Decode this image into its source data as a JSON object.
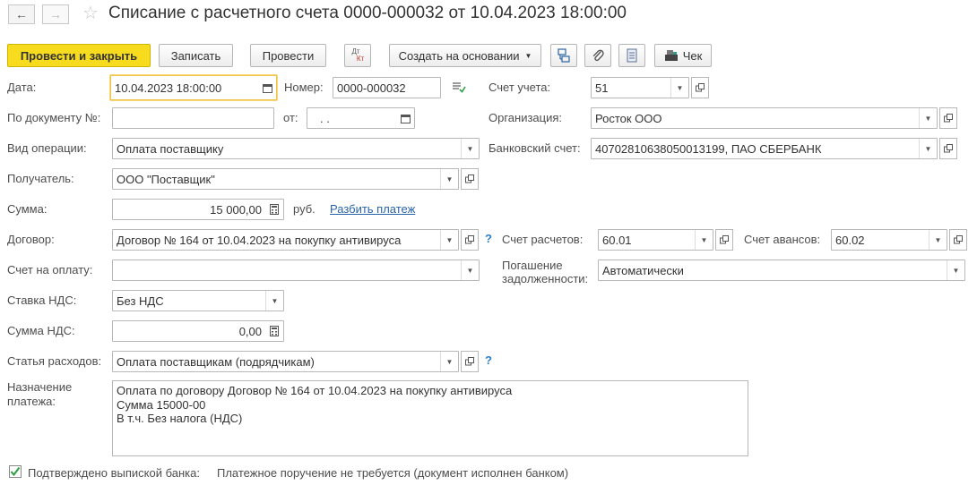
{
  "window": {
    "title": "Списание с расчетного счета 0000-000032 от 10.04.2023 18:00:00",
    "back_glyph": "←",
    "forward_glyph": "→",
    "favorite_glyph": "☆"
  },
  "toolbar": {
    "post_close": "Провести и закрыть",
    "save": "Записать",
    "post": "Провести",
    "dtkt_top": "Дт",
    "dtkt_bottom": "Кт",
    "create_based": "Создать на основании",
    "check": "Чек"
  },
  "icons": {
    "dropdown": "▾",
    "dropdown_small": "▼"
  },
  "form": {
    "date_label": "Дата:",
    "date_value": "10.04.2023 18:00:00",
    "number_label": "Номер:",
    "number_value": "0000-000032",
    "account_label": "Счет учета:",
    "account_value": "51",
    "bydoc_label": "По документу №:",
    "bydoc_value": "",
    "from_label": "от:",
    "from_value": " .  .",
    "org_label": "Организация:",
    "org_value": "Росток ООО",
    "optype_label": "Вид операции:",
    "optype_value": "Оплата поставщику",
    "bank_label": "Банковский счет:",
    "bank_value": "40702810638050013199, ПАО СБЕРБАНК",
    "recipient_label": "Получатель:",
    "recipient_value": "ООО \"Поставщик\"",
    "sum_label": "Сумма:",
    "sum_value": "15 000,00",
    "currency": "руб.",
    "split_link": "Разбить платеж",
    "contract_label": "Договор:",
    "contract_value": "Договор № 164 от 10.04.2023 на покупку антивируса",
    "help_mark": "?",
    "settle_label": "Счет расчетов:",
    "settle_value": "60.01",
    "advance_label": "Счет авансов:",
    "advance_value": "60.02",
    "invoice_label": "Счет на оплату:",
    "invoice_value": "",
    "repay_label_1": "Погашение",
    "repay_label_2": "задолженности:",
    "repay_value": "Автоматически",
    "vat_rate_label": "Ставка НДС:",
    "vat_rate_value": "Без НДС",
    "vat_sum_label": "Сумма НДС:",
    "vat_sum_value": "0,00",
    "expense_label": "Статья расходов:",
    "expense_value": "Оплата поставщикам (подрядчикам)",
    "purpose_label_1": "Назначение",
    "purpose_label_2": "платежа:",
    "purpose_line_1": "Оплата по договору Договор № 164 от 10.04.2023 на покупку антивируса",
    "purpose_line_2": "Сумма 15000-00",
    "purpose_line_3": "В т.ч. Без налога (НДС)",
    "confirmed_label": "Подтверждено выпиской банка:",
    "confirmed_checked": true,
    "payment_order_note": "Платежное поручение не требуется (документ исполнен банком)"
  }
}
